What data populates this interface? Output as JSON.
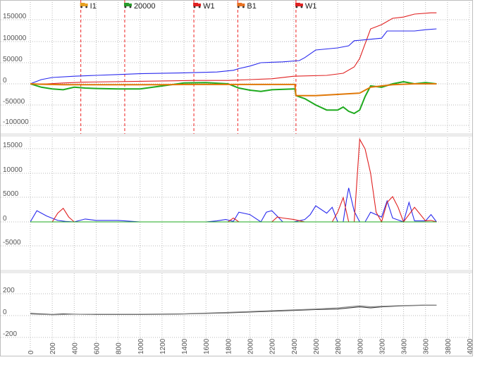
{
  "chart_data": [
    {
      "type": "line",
      "panel": "top",
      "x_ticks": [
        "0",
        "200",
        "400",
        "600",
        "800",
        "1000",
        "1200",
        "1400",
        "1600",
        "1800",
        "2000",
        "2200",
        "2400",
        "2600",
        "2800",
        "3000",
        "3200",
        "3400",
        "3600",
        "3800",
        "4000"
      ],
      "y_ticks": [
        "150000",
        "100000",
        "50000",
        "0",
        "-50000",
        "-100000"
      ],
      "ylim": [
        -120000,
        190000
      ],
      "xlim": [
        0,
        4000
      ],
      "grid": true,
      "markers": [
        {
          "x": 460,
          "label": "I1",
          "icon": "truck-icon",
          "color": "#e8a020"
        },
        {
          "x": 860,
          "label": "20000",
          "icon": "truck-icon",
          "color": "#2a9a2a"
        },
        {
          "x": 1490,
          "label": "W1",
          "icon": "truck-icon",
          "color": "#e02020"
        },
        {
          "x": 1890,
          "label": "B1",
          "icon": "truck-icon",
          "color": "#e87020"
        },
        {
          "x": 2420,
          "label": "W1",
          "icon": "truck-icon",
          "color": "#e02020"
        }
      ],
      "series": [
        {
          "color": "#e02020",
          "x": [
            0,
            150,
            300,
            500,
            1000,
            1500,
            1800,
            2000,
            2200,
            2400,
            2700,
            2850,
            2950,
            3000,
            3100,
            3200,
            3300,
            3400,
            3500,
            3650,
            3700
          ],
          "y": [
            0,
            0,
            2000,
            4000,
            6000,
            8000,
            8000,
            10000,
            12000,
            18000,
            20000,
            25000,
            40000,
            60000,
            130000,
            140000,
            155000,
            158000,
            165000,
            168000,
            168000
          ]
        },
        {
          "color": "#2a2aee",
          "x": [
            0,
            100,
            200,
            400,
            600,
            800,
            1000,
            1400,
            1700,
            1850,
            1900,
            2000,
            2100,
            2300,
            2450,
            2500,
            2600,
            2800,
            2900,
            2950,
            3000,
            3200,
            3250,
            3500,
            3600,
            3700
          ],
          "y": [
            0,
            10000,
            15000,
            18000,
            20000,
            22000,
            24000,
            26000,
            28000,
            32000,
            36000,
            42000,
            50000,
            52000,
            55000,
            62000,
            80000,
            85000,
            90000,
            102000,
            103000,
            108000,
            125000,
            125000,
            128000,
            130000
          ]
        },
        {
          "color": "#1eaa1e",
          "x": [
            0,
            100,
            200,
            300,
            400,
            500,
            600,
            800,
            1000,
            1200,
            1400,
            1600,
            1800,
            1900,
            2000,
            2100,
            2200,
            2400,
            2410,
            2420,
            2500,
            2600,
            2700,
            2800,
            2850,
            2900,
            2950,
            3000,
            3050,
            3100,
            3200,
            3300,
            3400,
            3500,
            3600,
            3700
          ],
          "y": [
            0,
            -8000,
            -12000,
            -14000,
            -8000,
            -10000,
            -11000,
            -12000,
            -12000,
            -5000,
            2000,
            3000,
            0,
            -10000,
            -15000,
            -18000,
            -14000,
            -12000,
            -12000,
            -28000,
            -35000,
            -50000,
            -62000,
            -62000,
            -55000,
            -65000,
            -70000,
            -62000,
            -30000,
            -5000,
            -8000,
            0,
            5000,
            0,
            3000,
            0
          ]
        },
        {
          "color": "#e07808",
          "x": [
            0,
            100,
            300,
            600,
            1200,
            1500,
            1800,
            2000,
            2200,
            2410,
            2420,
            2600,
            2800,
            3000,
            3050,
            3100,
            3200,
            3300,
            3400,
            3500,
            3600,
            3700
          ],
          "y": [
            0,
            -1000,
            -2000,
            -2000,
            -2000,
            -1500,
            -1500,
            -1500,
            -1500,
            -1500,
            -28000,
            -28000,
            -25000,
            -22000,
            -15000,
            -8000,
            -5000,
            -2000,
            -1000,
            0,
            0,
            0
          ]
        }
      ]
    },
    {
      "type": "line",
      "panel": "middle",
      "y_ticks": [
        "15000",
        "10000",
        "5000",
        "0",
        "-5000"
      ],
      "ylim": [
        -9500,
        18500
      ],
      "xlim": [
        0,
        4000
      ],
      "grid": true,
      "series": [
        {
          "color": "#2a2aee",
          "x": [
            0,
            60,
            150,
            250,
            320,
            400,
            500,
            600,
            800,
            1000,
            1200,
            1400,
            1600,
            1700,
            1780,
            1850,
            1900,
            2000,
            2100,
            2150,
            2200,
            2300,
            2400,
            2500,
            2550,
            2600,
            2700,
            2750,
            2800,
            2850,
            2880,
            2900,
            2950,
            3000,
            3050,
            3100,
            3200,
            3250,
            3300,
            3400,
            3450,
            3500,
            3600,
            3650,
            3700
          ],
          "y": [
            0,
            2300,
            1200,
            300,
            100,
            0,
            600,
            300,
            300,
            0,
            0,
            0,
            0,
            200,
            500,
            100,
            2000,
            1500,
            0,
            2000,
            2300,
            0,
            0,
            500,
            1500,
            3300,
            1800,
            3000,
            0,
            0,
            4500,
            7000,
            2200,
            0,
            0,
            2000,
            1000,
            4300,
            800,
            0,
            4000,
            200,
            200,
            1500,
            0
          ]
        },
        {
          "color": "#e02020",
          "x": [
            0,
            200,
            250,
            300,
            350,
            400,
            1000,
            1700,
            1800,
            1850,
            1900,
            2200,
            2250,
            2300,
            2400,
            2500,
            2600,
            2750,
            2800,
            2850,
            2900,
            2950,
            3000,
            3050,
            3100,
            3150,
            3200,
            3250,
            3300,
            3350,
            3400,
            3450,
            3500,
            3600,
            3650,
            3700
          ],
          "y": [
            0,
            0,
            1800,
            2800,
            1000,
            0,
            0,
            0,
            0,
            800,
            0,
            0,
            1000,
            800,
            500,
            0,
            0,
            0,
            2000,
            5000,
            0,
            0,
            17000,
            15000,
            10000,
            2000,
            0,
            4000,
            5200,
            3000,
            0,
            1500,
            3000,
            200,
            300,
            0
          ]
        },
        {
          "color": "#1eaa1e",
          "x": [
            0,
            3700
          ],
          "y": [
            0,
            0
          ]
        }
      ]
    },
    {
      "type": "line",
      "panel": "bottom",
      "y_ticks": [
        "200",
        "0",
        "-200"
      ],
      "ylim": [
        -290,
        330
      ],
      "xlim": [
        0,
        4000
      ],
      "grid": true,
      "series": [
        {
          "color": "#3a3a3a",
          "x": [
            0,
            200,
            300,
            600,
            1000,
            1400,
            1800,
            2200,
            2600,
            2800,
            3000,
            3100,
            3200,
            3400,
            3600,
            3700
          ],
          "y": [
            20,
            10,
            15,
            10,
            10,
            15,
            25,
            40,
            55,
            60,
            80,
            70,
            80,
            90,
            95,
            95
          ]
        },
        {
          "color": "#888888",
          "x": [
            0,
            200,
            400,
            600,
            1000,
            1400,
            1800,
            2200,
            2600,
            2800,
            3000,
            3100,
            3200,
            3400,
            3600,
            3700
          ],
          "y": [
            15,
            8,
            12,
            12,
            12,
            17,
            30,
            45,
            60,
            70,
            90,
            80,
            85,
            92,
            96,
            95
          ]
        }
      ]
    }
  ]
}
